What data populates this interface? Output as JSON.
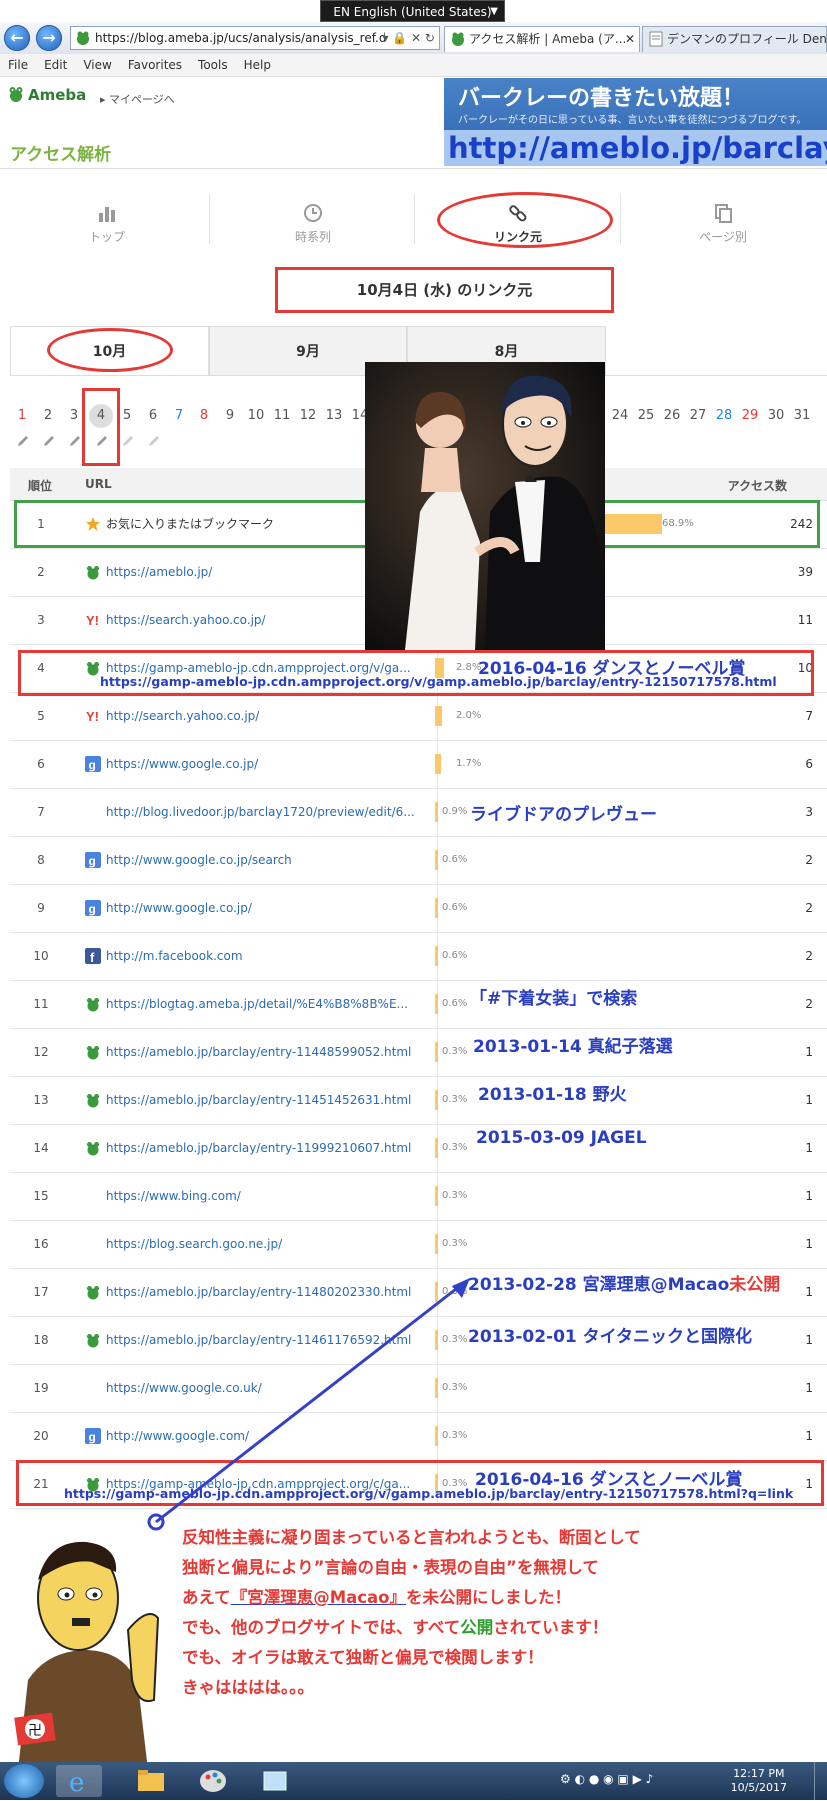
{
  "browser": {
    "language_bar": "EN English (United States)",
    "address_url": "https://blog.ameba.jp/ucs/analysis/analysis_ref.do",
    "tabs": [
      {
        "label": "アクセス解析 | Ameba (ア...",
        "active": true
      },
      {
        "label": "デンマンのプロフィール Den..."
      }
    ],
    "menu": [
      "File",
      "Edit",
      "View",
      "Favorites",
      "Tools",
      "Help"
    ]
  },
  "header": {
    "logo": "Ameba",
    "mypage_link": "マイページへ",
    "page_title": "アクセス解析"
  },
  "banner": {
    "title": "バークレーの書きたい放題！",
    "subtitle": "バークレーがその日に思っている事、言いたい事を徒然につづるブログです。",
    "url": "http://ameblo.jp/barclay"
  },
  "topnav": [
    {
      "label": "トップ",
      "icon": "bar-chart-icon"
    },
    {
      "label": "時系列",
      "icon": "clock-icon"
    },
    {
      "label": "リンク元",
      "icon": "link-icon",
      "active": true
    },
    {
      "label": "ページ別",
      "icon": "pages-icon"
    }
  ],
  "date_title": "10月4日 (水) のリンク元",
  "months": [
    "10月",
    "9月",
    "8月"
  ],
  "days": [
    "1",
    "2",
    "3",
    "4",
    "5",
    "6",
    "7",
    "8",
    "9",
    "10",
    "11",
    "12",
    "13",
    "14",
    "24",
    "25",
    "26",
    "27",
    "28",
    "29",
    "30",
    "31"
  ],
  "table": {
    "headers": {
      "rank": "順位",
      "url": "URL",
      "count": "アクセス数"
    },
    "rows": [
      {
        "rank": "1",
        "icon": "star-icon",
        "url": "お気に入りまたはブックマーク",
        "pct": "68.9%",
        "bar": 68.9,
        "count": "242"
      },
      {
        "rank": "2",
        "icon": "ameba-icon",
        "url": "https://ameblo.jp/",
        "pct": "",
        "bar": 0,
        "count": "39"
      },
      {
        "rank": "3",
        "icon": "yahoo-icon",
        "url": "https://search.yahoo.co.jp/",
        "pct": "",
        "bar": 0,
        "count": "11"
      },
      {
        "rank": "4",
        "icon": "ameba-icon",
        "url": "https://gamp-ameblo-jp.cdn.ampproject.org/v/ga...",
        "pct": "2.8%",
        "bar": 2.8,
        "count": "10"
      },
      {
        "rank": "5",
        "icon": "yahoo-icon",
        "url": "http://search.yahoo.co.jp/",
        "pct": "2.0%",
        "bar": 2.0,
        "count": "7"
      },
      {
        "rank": "6",
        "icon": "google-icon",
        "url": "https://www.google.co.jp/",
        "pct": "1.7%",
        "bar": 1.7,
        "count": "6"
      },
      {
        "rank": "7",
        "icon": "",
        "url": "http://blog.livedoor.jp/barclay1720/preview/edit/6...",
        "pct": "0.9%",
        "bar": 0.9,
        "count": "3"
      },
      {
        "rank": "8",
        "icon": "google-icon",
        "url": "http://www.google.co.jp/search",
        "pct": "0.6%",
        "bar": 0.6,
        "count": "2"
      },
      {
        "rank": "9",
        "icon": "google-icon",
        "url": "http://www.google.co.jp/",
        "pct": "0.6%",
        "bar": 0.6,
        "count": "2"
      },
      {
        "rank": "10",
        "icon": "facebook-icon",
        "url": "http://m.facebook.com",
        "pct": "0.6%",
        "bar": 0.6,
        "count": "2"
      },
      {
        "rank": "11",
        "icon": "ameba-icon",
        "url": "https://blogtag.ameba.jp/detail/%E4%B8%8B%E...",
        "pct": "0.6%",
        "bar": 0.6,
        "count": "2"
      },
      {
        "rank": "12",
        "icon": "ameba-icon",
        "url": "https://ameblo.jp/barclay/entry-11448599052.html",
        "pct": "0.3%",
        "bar": 0.3,
        "count": "1"
      },
      {
        "rank": "13",
        "icon": "ameba-icon",
        "url": "https://ameblo.jp/barclay/entry-11451452631.html",
        "pct": "0.3%",
        "bar": 0.3,
        "count": "1"
      },
      {
        "rank": "14",
        "icon": "ameba-icon",
        "url": "https://ameblo.jp/barclay/entry-11999210607.html",
        "pct": "0.3%",
        "bar": 0.3,
        "count": "1"
      },
      {
        "rank": "15",
        "icon": "",
        "url": "https://www.bing.com/",
        "pct": "0.3%",
        "bar": 0.3,
        "count": "1"
      },
      {
        "rank": "16",
        "icon": "",
        "url": "https://blog.search.goo.ne.jp/",
        "pct": "0.3%",
        "bar": 0.3,
        "count": "1"
      },
      {
        "rank": "17",
        "icon": "ameba-icon",
        "url": "https://ameblo.jp/barclay/entry-11480202330.html",
        "pct": "0.3%",
        "bar": 0.3,
        "count": "1"
      },
      {
        "rank": "18",
        "icon": "ameba-icon",
        "url": "https://ameblo.jp/barclay/entry-11461176592.html",
        "pct": "0.3%",
        "bar": 0.3,
        "count": "1"
      },
      {
        "rank": "19",
        "icon": "",
        "url": "https://www.google.co.uk/",
        "pct": "0.3%",
        "bar": 0.3,
        "count": "1"
      },
      {
        "rank": "20",
        "icon": "google-icon",
        "url": "http://www.google.com/",
        "pct": "0.3%",
        "bar": 0.3,
        "count": "1"
      },
      {
        "rank": "21",
        "icon": "ameba-icon",
        "url": "https://gamp-ameblo-jp.cdn.ampproject.org/c/ga...",
        "pct": "0.3%",
        "bar": 0.3,
        "count": "1"
      }
    ]
  },
  "annotations": {
    "row4_title": "2016-04-16 ダンスとノーベル賞",
    "row4_url": "https://gamp-ameblo-jp.cdn.ampproject.org/v/gamp.ameblo.jp/barclay/entry-12150717578.html",
    "row7": "ライブドアのプレヴュー",
    "row11": "「#下着女装」で検索",
    "row12": "2013-01-14 真紀子落選",
    "row13": "2013-01-18 野火",
    "row14": "2015-03-09 JAGEL",
    "row17_a": "2013-02-28 宮澤理恵@Macao",
    "row17_b": "未公開",
    "row18": "2013-02-01 タイタニックと国際化",
    "row21_title": "2016-04-16 ダンスとノーベル賞",
    "row21_url": "https://gamp-ameblo-jp.cdn.ampproject.org/v/gamp.ameblo.jp/barclay/entry-12150717578.html?q=link"
  },
  "commentary": {
    "l1": "反知性主義に凝り固まっていると言われようとも、断固として",
    "l2": "独断と偏見により”言論の自由・表現の自由”を無視して",
    "l3a": "あえて",
    "l3b": "『宮澤理恵@Macao』",
    "l3c": "を未公開にしました！",
    "l4a": "でも、他のブログサイトでは、すべて",
    "l4b": "公開",
    "l4c": "されています！",
    "l5": "でも、オイラは敢えて独断と偏見で検閲します！",
    "l6": "きゃはははは。。。"
  },
  "taskbar": {
    "time": "12:17 PM",
    "date": "10/5/2017"
  }
}
